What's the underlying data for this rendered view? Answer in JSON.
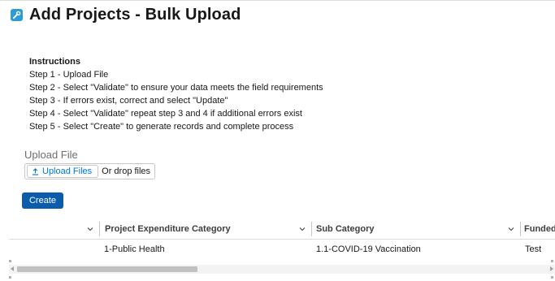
{
  "header": {
    "title": "Add Projects - Bulk Upload",
    "icon": "wrench-icon",
    "icon_color": "#2d9cd6"
  },
  "instructions": {
    "heading": "Instructions",
    "steps": [
      "Step 1 - Upload File",
      "Step 2 - Select \"Validate\" to ensure your data meets the field requirements",
      "Step 3 - If errors exist, correct and select \"Update\"",
      "Step 4 - Select \"Validate\" repeat step 3 and 4 if additional errors exist",
      "Step 5 - Select \"Create\" to generate records and complete process"
    ]
  },
  "upload": {
    "label": "Upload File",
    "button_label": "Upload Files",
    "drop_text": "Or drop files"
  },
  "create_button": {
    "label": "Create",
    "color": "#0b5cab"
  },
  "table": {
    "headers": [
      "Project Expenditure Category",
      "Sub Category",
      "Funded"
    ],
    "rows": [
      {
        "category": "1-Public Health",
        "sub_category": "1.1-COVID-19 Vaccination",
        "funded": "Test"
      }
    ]
  }
}
